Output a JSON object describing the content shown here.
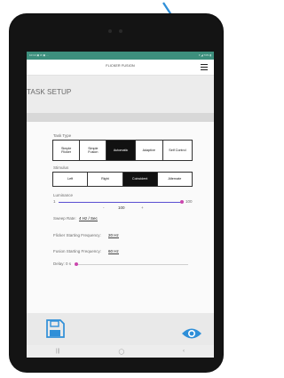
{
  "status_bar": {
    "left": "10:14 ▣ ⊘ ▣ ···",
    "right": "▾ ◢ 73% ▮"
  },
  "app": {
    "title": "FLICKER FUSION"
  },
  "setup": {
    "title": "TASK SETUP"
  },
  "task_type": {
    "label": "Task Type",
    "options": [
      "Simple\nFlicker",
      "Simple\nFusion",
      "Automatic",
      "Adaptive",
      "Self Control"
    ],
    "selected": "Automatic"
  },
  "stimulus": {
    "label": "Stimulus",
    "options": [
      "Left",
      "Right",
      "Coincident",
      "Alternate"
    ],
    "selected": "Coincident"
  },
  "luminance": {
    "label": "Luminance",
    "min": "1",
    "max": "100",
    "value": "100",
    "minus": "-",
    "plus": "+",
    "level": 1.0
  },
  "sweep": {
    "label": "Sweep Rate:",
    "value": "4 Hz / Sec"
  },
  "flicker": {
    "label": "Flicker Starting Frequency:",
    "value": "20 Hz"
  },
  "fusion": {
    "label": "Fusion Starting Frequency:",
    "value": "60 Hz"
  },
  "delay": {
    "label": "Delay: 0 s",
    "level": 0.0
  },
  "nav": {
    "recents": "|||",
    "home": "◯",
    "back": "‹"
  },
  "colors": {
    "accent": "#2f8fd8",
    "status_bar": "#3d8f7d",
    "slider": "#5a4fd2",
    "knob": "#cb47ad"
  }
}
